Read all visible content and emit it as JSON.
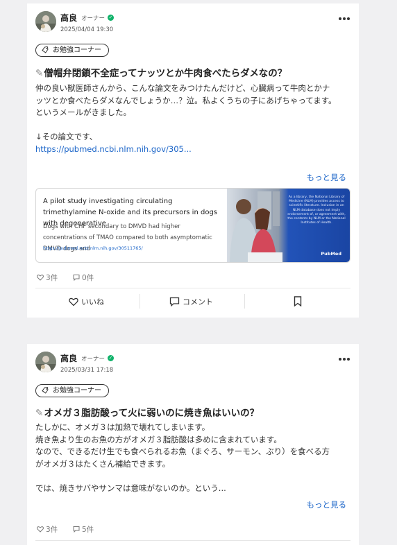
{
  "posts": [
    {
      "author": "高良",
      "role": "オーナー",
      "date": "2025/04/04 19:30",
      "tag": "お勉強コーナー",
      "title_icon": "✎",
      "title": "僧帽弁閉鎖不全症ってナッツとか牛肉食べたらダメなの？",
      "body_lines": [
        "仲の良い獣医師さんから、こんな論文をみつけたんだけど、心臓病って牛肉とかナ",
        "ッツとか食べたらダメなんでしょうか…？泣。私よくうちの子にあげちゃってます。",
        "というメールがきました。",
        "",
        "↓その論文です、"
      ],
      "link": "https://pubmed.ncbi.nlm.nih.gov/305...",
      "more": "もっと見る",
      "preview": {
        "title": "A pilot study investigating circulating trimethylamine N-oxide and its precursors in dogs with degenerative",
        "description": "Dogs with CHF secondary to DMVD had higher concentrations of TMAO compared to both asymptomatic DMVD dogs and",
        "url": "https://pubmed.ncbi.nlm.nih.gov/30511765/",
        "image_text": "As a library, the National Library of Medicine (NLM) provides access to scientific literature. Inclusion in an NLM database does not imply endorsement of, or agreement with, the contents by NLM or the National Institutes of Health.",
        "image_logo": "PubMed"
      },
      "likes": "3件",
      "comments": "0件",
      "actions": {
        "like": "いいね",
        "comment": "コメント"
      }
    },
    {
      "author": "高良",
      "role": "オーナー",
      "date": "2025/03/31 17:18",
      "tag": "お勉強コーナー",
      "title_icon": "✎",
      "title": "オメガ３脂肪酸って火に弱いのに焼き魚はいいの？",
      "body_lines": [
        "たしかに、オメガ３は加熱で壊れてしまいます。",
        "焼き魚より生のお魚の方がオメガ３脂肪酸は多めに含まれています。",
        "なので、できるだけ生でも食べられるお魚（まぐろ、サーモン、ぶり）を食べる方",
        "がオメガ３はたくさん補給できます。",
        "",
        "では、焼きサバやサンマは意味がないのか。という..."
      ],
      "more": "もっと見る",
      "likes": "3件",
      "comments": "5件"
    }
  ],
  "colors": {
    "accent": "#1a64c8",
    "verified": "#10b26a",
    "pubmed_blue": "#1d4fb0"
  }
}
